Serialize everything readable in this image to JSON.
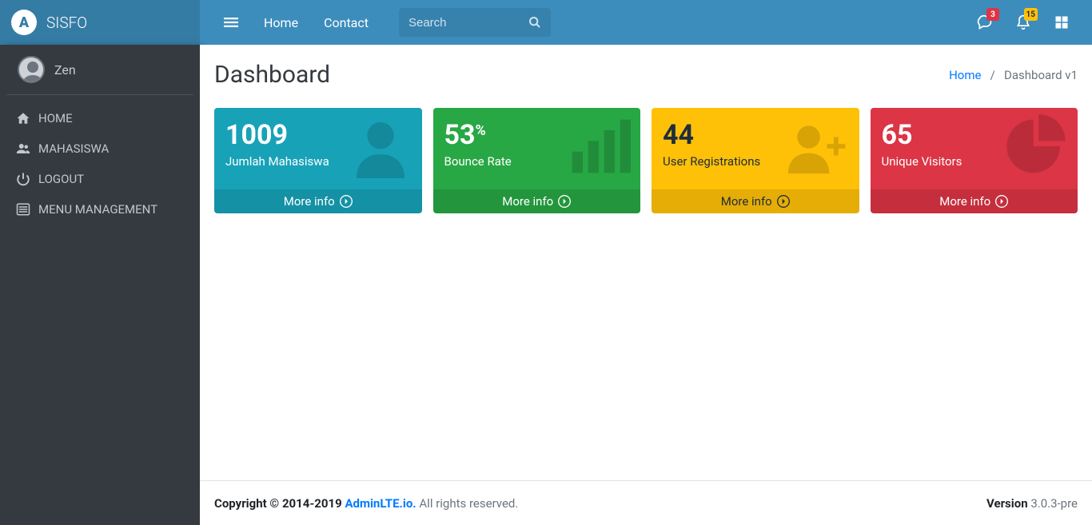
{
  "brand": {
    "text": "SISFO",
    "logo_glyph": "A"
  },
  "navbar": {
    "links": {
      "home": "Home",
      "contact": "Contact"
    },
    "search": {
      "placeholder": "Search"
    },
    "badges": {
      "comments": "3",
      "notifications": "15"
    }
  },
  "sidebar": {
    "user": "Zen",
    "items": [
      {
        "icon": "home",
        "label": "HOME"
      },
      {
        "icon": "users",
        "label": "MAHASISWA"
      },
      {
        "icon": "power",
        "label": "LOGOUT"
      },
      {
        "icon": "list",
        "label": "MENU MANAGEMENT"
      }
    ]
  },
  "header": {
    "title": "Dashboard",
    "breadcrumb": {
      "home": "Home",
      "current": "Dashboard v1",
      "separator": "/"
    }
  },
  "boxes": [
    {
      "value": "1009",
      "sup": "",
      "label": "Jumlah Mahasiswa",
      "more": "More info",
      "icon": "person"
    },
    {
      "value": "53",
      "sup": "%",
      "label": "Bounce Rate",
      "more": "More info",
      "icon": "stats"
    },
    {
      "value": "44",
      "sup": "",
      "label": "User Registrations",
      "more": "More info",
      "icon": "person-add"
    },
    {
      "value": "65",
      "sup": "",
      "label": "Unique Visitors",
      "more": "More info",
      "icon": "pie"
    }
  ],
  "footer": {
    "copyright_prefix": "Copyright © 2014-2019 ",
    "link_text": "AdminLTE.io.",
    "suffix": " All rights reserved.",
    "version_label": "Version",
    "version_value": " 3.0.3-pre"
  }
}
